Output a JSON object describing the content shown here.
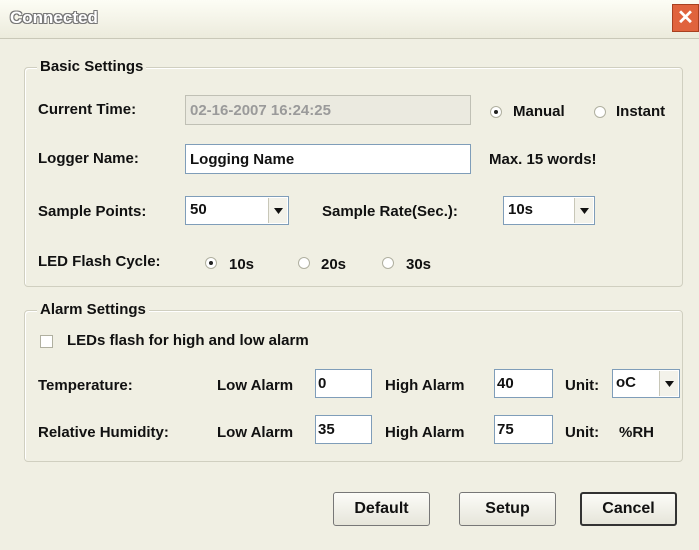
{
  "window": {
    "title": "Connected",
    "close_glyph": "✕"
  },
  "basic": {
    "legend": "Basic Settings",
    "current_time_label": "Current Time:",
    "current_time_value": "02-16-2007 16:24:25",
    "manual_label": "Manual",
    "instant_label": "Instant",
    "time_mode_selected": "Manual",
    "logger_name_label": "Logger Name:",
    "logger_name_value": "Logging Name",
    "max_note": "Max. 15 words!",
    "sample_points_label": "Sample Points:",
    "sample_points_value": "50",
    "sample_rate_label": "Sample Rate(Sec.):",
    "sample_rate_value": "10s",
    "led_cycle_label": "LED Flash Cycle:",
    "led_options": [
      "10s",
      "20s",
      "30s"
    ],
    "led_selected": "10s"
  },
  "alarm": {
    "legend": "Alarm Settings",
    "led_flash_checkbox_label": "LEDs flash for high and low alarm",
    "led_flash_checked": false,
    "temperature_label": "Temperature:",
    "humidity_label": "Relative Humidity:",
    "low_alarm_label": "Low Alarm",
    "high_alarm_label": "High Alarm",
    "unit_label": "Unit:",
    "temp_low": "0",
    "temp_high": "40",
    "temp_unit": "oC",
    "hum_low": "35",
    "hum_high": "75",
    "hum_unit": "%RH"
  },
  "buttons": {
    "default": "Default",
    "setup": "Setup",
    "cancel": "Cancel"
  },
  "colors": {
    "title_close": "#e0633d",
    "window_bg": "#f0efe3"
  }
}
